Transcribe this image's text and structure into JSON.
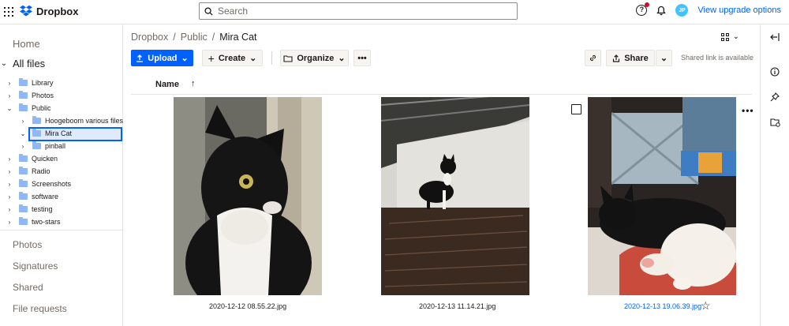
{
  "app": {
    "brand": "Dropbox",
    "brand_color": "#0061fe"
  },
  "search": {
    "placeholder": "Search"
  },
  "header": {
    "avatar_initials": "JP",
    "upgrade_link": "View upgrade options"
  },
  "sidebar": {
    "home": "Home",
    "all_files": "All files",
    "tree": [
      {
        "label": "Library",
        "depth": 1,
        "expanded": false
      },
      {
        "label": "Photos",
        "depth": 1,
        "expanded": false
      },
      {
        "label": "Public",
        "depth": 1,
        "expanded": true
      },
      {
        "label": "Hoogeboom various files",
        "depth": 2,
        "expanded": false
      },
      {
        "label": "Mira Cat",
        "depth": 2,
        "expanded": true,
        "selected": true
      },
      {
        "label": "pinball",
        "depth": 2,
        "expanded": false
      },
      {
        "label": "Quicken",
        "depth": 1,
        "expanded": false
      },
      {
        "label": "Radio",
        "depth": 1,
        "expanded": false
      },
      {
        "label": "Screenshots",
        "depth": 1,
        "expanded": false
      },
      {
        "label": "software",
        "depth": 1,
        "expanded": false
      },
      {
        "label": "testing",
        "depth": 1,
        "expanded": false
      },
      {
        "label": "two-stars",
        "depth": 1,
        "expanded": false
      }
    ],
    "lower": [
      "Photos",
      "Signatures",
      "Shared",
      "File requests"
    ]
  },
  "breadcrumb": {
    "items": [
      "Dropbox",
      "Public"
    ],
    "current": "Mira Cat"
  },
  "toolbar": {
    "upload": "Upload",
    "create": "Create",
    "organize": "Organize",
    "more": "•••",
    "share": "Share",
    "shared_note": "Shared link is available"
  },
  "list": {
    "column_name": "Name"
  },
  "files": [
    {
      "name": "2020-12-12 08.55.22.jpg",
      "highlighted": false
    },
    {
      "name": "2020-12-13 11.14.21.jpg",
      "highlighted": false
    },
    {
      "name": "2020-12-13 19.06.39.jpg",
      "highlighted": true
    }
  ]
}
